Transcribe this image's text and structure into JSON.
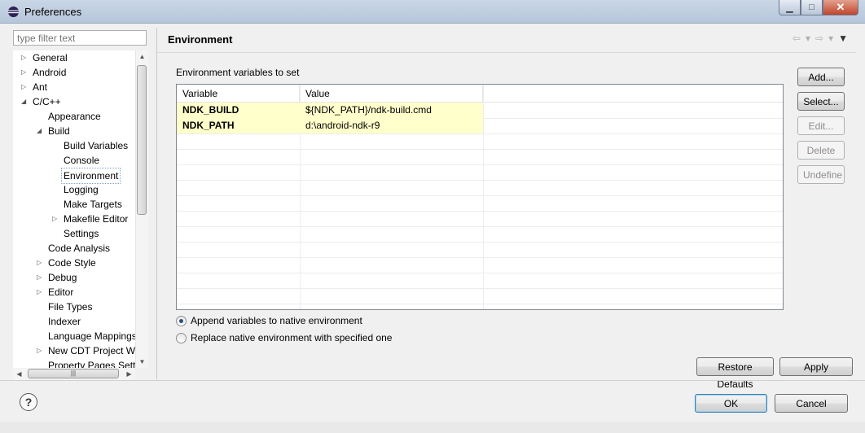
{
  "window": {
    "title": "Preferences"
  },
  "filter": {
    "placeholder": "type filter text"
  },
  "tree": [
    {
      "label": "General",
      "level": 0,
      "toggle": "collapsed"
    },
    {
      "label": "Android",
      "level": 0,
      "toggle": "collapsed"
    },
    {
      "label": "Ant",
      "level": 0,
      "toggle": "collapsed"
    },
    {
      "label": "C/C++",
      "level": 0,
      "toggle": "expanded"
    },
    {
      "label": "Appearance",
      "level": 1,
      "toggle": "none"
    },
    {
      "label": "Build",
      "level": 1,
      "toggle": "expanded"
    },
    {
      "label": "Build Variables",
      "level": 2,
      "toggle": "none"
    },
    {
      "label": "Console",
      "level": 2,
      "toggle": "none"
    },
    {
      "label": "Environment",
      "level": 2,
      "toggle": "none",
      "selected": true
    },
    {
      "label": "Logging",
      "level": 2,
      "toggle": "none"
    },
    {
      "label": "Make Targets",
      "level": 2,
      "toggle": "none"
    },
    {
      "label": "Makefile Editor",
      "level": 2,
      "toggle": "collapsed"
    },
    {
      "label": "Settings",
      "level": 2,
      "toggle": "none"
    },
    {
      "label": "Code Analysis",
      "level": 1,
      "toggle": "none"
    },
    {
      "label": "Code Style",
      "level": 1,
      "toggle": "collapsed"
    },
    {
      "label": "Debug",
      "level": 1,
      "toggle": "collapsed"
    },
    {
      "label": "Editor",
      "level": 1,
      "toggle": "collapsed"
    },
    {
      "label": "File Types",
      "level": 1,
      "toggle": "none"
    },
    {
      "label": "Indexer",
      "level": 1,
      "toggle": "none"
    },
    {
      "label": "Language Mappings",
      "level": 1,
      "toggle": "none"
    },
    {
      "label": "New CDT Project Wi",
      "level": 1,
      "toggle": "collapsed"
    },
    {
      "label": "Property Pages Setti",
      "level": 1,
      "toggle": "none"
    }
  ],
  "page": {
    "title": "Environment",
    "section_label": "Environment variables to set",
    "columns": [
      "Variable",
      "Value"
    ],
    "rows": [
      {
        "variable": "NDK_BUILD",
        "value": "${NDK_PATH}/ndk-build.cmd"
      },
      {
        "variable": "NDK_PATH",
        "value": "d:\\android-ndk-r9"
      }
    ],
    "side_buttons": {
      "add": "Add...",
      "select": "Select...",
      "edit": "Edit...",
      "delete": "Delete",
      "undefine": "Undefine"
    },
    "radio_append": "Append variables to native environment",
    "radio_replace": "Replace native environment with specified one",
    "restore_defaults": "Restore Defaults",
    "apply": "Apply"
  },
  "footer": {
    "ok": "OK",
    "cancel": "Cancel",
    "help": "?"
  },
  "colors": {
    "highlight_row": "#ffffcc",
    "selection_border": "#7da2ce"
  }
}
